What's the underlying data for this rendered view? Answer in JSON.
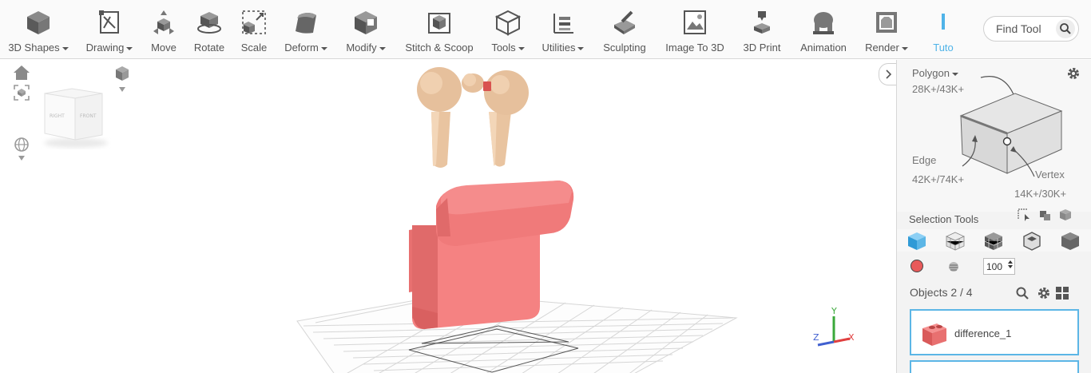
{
  "toolbar": {
    "items": [
      {
        "label": "3D Shapes",
        "icon": "cube-icon",
        "dropdown": true
      },
      {
        "label": "Drawing",
        "icon": "drawing-icon",
        "dropdown": true
      },
      {
        "label": "Move",
        "icon": "move-icon",
        "dropdown": false
      },
      {
        "label": "Rotate",
        "icon": "rotate-icon",
        "dropdown": false
      },
      {
        "label": "Scale",
        "icon": "scale-icon",
        "dropdown": false
      },
      {
        "label": "Deform",
        "icon": "deform-icon",
        "dropdown": true
      },
      {
        "label": "Modify",
        "icon": "modify-icon",
        "dropdown": true
      },
      {
        "label": "Stitch & Scoop",
        "icon": "stitch-scoop-icon",
        "dropdown": false
      },
      {
        "label": "Tools",
        "icon": "tools-icon",
        "dropdown": true
      },
      {
        "label": "Utilities",
        "icon": "utilities-icon",
        "dropdown": true
      },
      {
        "label": "Sculpting",
        "icon": "sculpting-icon",
        "dropdown": false
      },
      {
        "label": "Image To 3D",
        "icon": "image-to-3d-icon",
        "dropdown": false
      },
      {
        "label": "3D Print",
        "icon": "3d-print-icon",
        "dropdown": false
      },
      {
        "label": "Animation",
        "icon": "animation-icon",
        "dropdown": false
      },
      {
        "label": "Render",
        "icon": "render-icon",
        "dropdown": true
      },
      {
        "label": "Tuto",
        "icon": "tutorial-icon",
        "dropdown": false
      }
    ],
    "find_tool_placeholder": "Find Tool"
  },
  "viewport": {
    "nav_cube_faces": [
      "RIGHT",
      "FRONT"
    ],
    "axis_labels": {
      "y": "Y",
      "z": "Z",
      "x": "X"
    },
    "object_colors": {
      "earbuds": "#efc8a4",
      "case": "#f08080"
    }
  },
  "panel": {
    "selection_mode": {
      "polygon_label": "Polygon",
      "polygon_count": "28K+/43K+",
      "edge_label": "Edge",
      "edge_count": "42K+/74K+",
      "vertex_label": "Vertex",
      "vertex_count": "14K+/30K+"
    },
    "selection_tools_title": "Selection Tools",
    "brush_size": "100",
    "paint_color": "#e85a5a",
    "objects_title": "Objects 2 / 4",
    "objects": [
      {
        "name": "difference_1",
        "selected": true
      }
    ]
  },
  "colors": {
    "accent": "#5cb6e6",
    "toolbar_bg": "#fafafa",
    "panel_bg": "#f3f3f3"
  }
}
